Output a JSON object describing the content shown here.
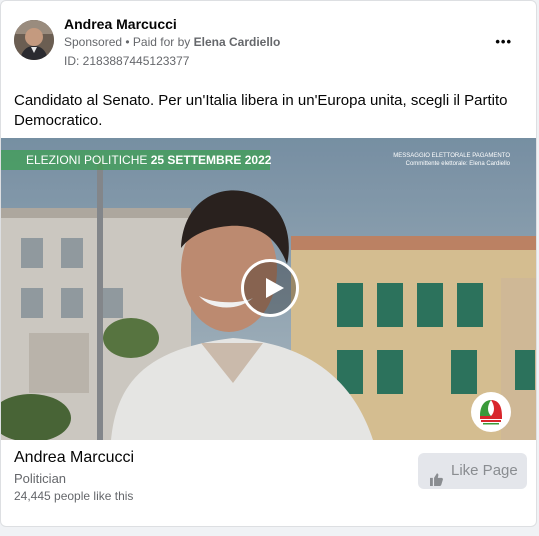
{
  "post": {
    "author": "Andrea Marcucci",
    "sponsored": "Sponsored",
    "paid_prefix": " • Paid for by ",
    "paid_by": "Elena Cardiello",
    "id_line": "ID: 2183887445123377",
    "more": "•••",
    "body": "Candidato al Senato. Per un'Italia libera in un'Europa unita, scegli il Partito Democratico."
  },
  "video": {
    "banner_text": "ELEZIONI POLITICHE ",
    "banner_date": "25 SETTEMBRE 2022",
    "disclaimer_line1": "MESSAGGIO ELETTORALE PAGAMENTO",
    "disclaimer_line2": "Committente elettorale: Elena Cardiello"
  },
  "page": {
    "name": "Andrea Marcucci",
    "category": "Politician",
    "likes": "24,445 people like this",
    "like_label": "Like Page"
  },
  "colors": {
    "banner": "#3ca050",
    "button_bg": "#e4e6eb",
    "button_text": "#8a8d91",
    "text_primary": "#050505",
    "text_secondary": "#65676b"
  },
  "icons": [
    "more-options-icon",
    "play-icon",
    "thumbs-up-icon",
    "party-logo"
  ]
}
